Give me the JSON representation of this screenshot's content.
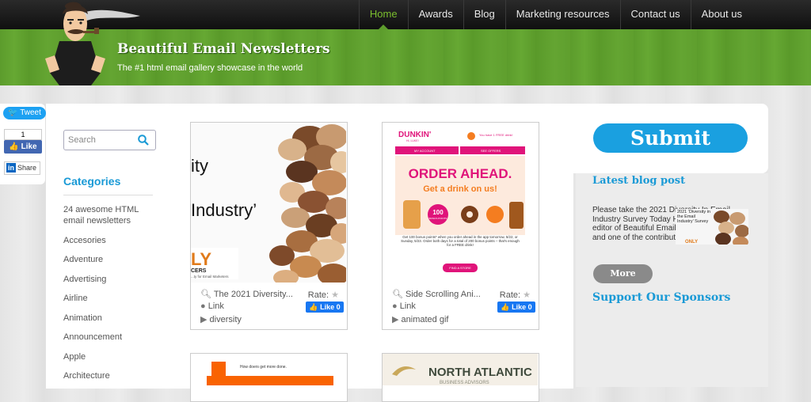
{
  "header": {
    "site_title": "Beautiful Email Newsletters",
    "tagline": "The #1 html email gallery showcase in the world",
    "nav": [
      {
        "label": "Home",
        "active": true
      },
      {
        "label": "Awards"
      },
      {
        "label": "Blog"
      },
      {
        "label": "Marketing resources"
      },
      {
        "label": "Contact us"
      },
      {
        "label": "About us"
      }
    ]
  },
  "share": {
    "tweet_label": "Tweet",
    "fb_count": "1",
    "fb_like_label": "Like",
    "linkedin_label": "Share",
    "linkedin_icon_text": "in"
  },
  "search": {
    "placeholder": "Search"
  },
  "categories": {
    "heading": "Categories",
    "items": [
      "24 awesome HTML email newsletters",
      "Accesories",
      "Adventure",
      "Advertising",
      "Airline",
      "Animation",
      "Announcement",
      "Apple",
      "Architecture"
    ]
  },
  "cards": [
    {
      "thumb_text": {
        "line1": "ity",
        "line2": "Industry’",
        "brand": "LY",
        "sub": "CERS",
        "small": "...ty for Email Marketers"
      },
      "title": "The 2021 Diversity...",
      "rate_label": "Rate:",
      "link_label": "Link",
      "tag": "diversity",
      "like_label": "Like",
      "like_count": "0"
    },
    {
      "thumb_text": {
        "brand": "DUNKIN'",
        "sub": "HI, LUKE!",
        "offer": "You have 1 FREE drink!",
        "tab1": "MY ACCOUNT",
        "tab2": "SEE OFFERS",
        "headline": "ORDER AHEAD.",
        "subhead": "Get a drink on us!",
        "badge1": "100",
        "badge2": "BONUS POINTS",
        "body": "Get 100 bonus points* when you order ahead in the app tomorrow, 5/22, or Sunday, 5/23. Order both days for a total of 200 bonus points – that's enough for a FREE drink!",
        "cta": "FIND A STORE"
      },
      "title": "Side Scrolling Ani...",
      "rate_label": "Rate:",
      "link_label": "Link",
      "tag": "animated gif",
      "like_label": "Like",
      "like_count": "0"
    },
    {
      "thumb_text": {
        "line1": "How doers get more done."
      }
    },
    {
      "thumb_text": {
        "line1": "NORTH ATLANTIC",
        "line2": "BUSINESS ADVISORS"
      }
    }
  ],
  "right": {
    "submit_label": "Submit",
    "blog_heading": "Latest blog post",
    "blog_excerpt": "Please take the 2021 Diversity In Email Industry Survey Today Hi! I'm Luke, the editor of Beautiful Email Newsletters and one of the contributors to",
    "blog_thumb_text": "2021 ‘Diversity in the Email Industry’ Survey",
    "blog_thumb_brand": "ONLY",
    "more_label": "More",
    "sponsors_heading": "Support Our Sponsors"
  },
  "colors": {
    "accent": "#1a9ad6",
    "nav_active": "#7bbf2e",
    "banner": "#5f9f2e",
    "dunkin_pink": "#e0147a",
    "dunkin_orange": "#f47d20"
  }
}
